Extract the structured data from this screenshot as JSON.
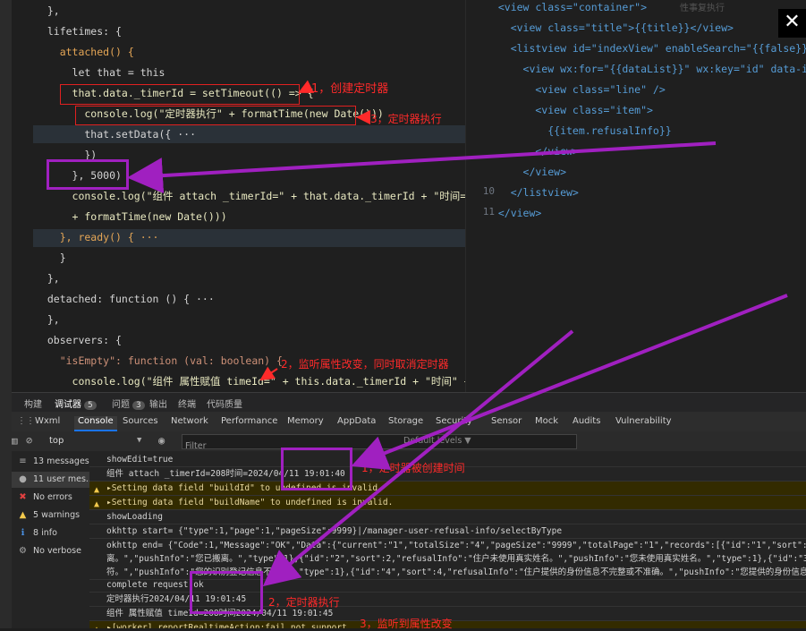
{
  "top_text": "性事复执行",
  "editor": {
    "lines": [
      {
        "t": "  },"
      },
      {
        "t": "  lifetimes: {"
      },
      {
        "t": "    attached() {"
      },
      {
        "t": "      let that = this"
      },
      {
        "t": "      that.data._timerId = setTimeout(() => {"
      },
      {
        "t": "        console.log(\"定时器执行\" + formatTime(new Date()))"
      },
      {
        "t": "        that.setData({ ···"
      },
      {
        "t": "        })"
      },
      {
        "t": "      }, 5000)"
      },
      {
        "t": "      console.log(\"组件 attach _timerId=\" + that.data._timerId + \"时间=\""
      },
      {
        "t": "      + formatTime(new Date()))"
      },
      {
        "t": "    }, ready() { ···"
      },
      {
        "t": "    }"
      },
      {
        "t": "  },"
      },
      {
        "t": "  detached: function () { ···"
      },
      {
        "t": "  },"
      },
      {
        "t": "  observers: {"
      },
      {
        "t": "    \"isEmpty\": function (val: boolean) {"
      },
      {
        "t": "      console.log(\"组件 属性赋值 timeId=\" + this.data._timerId + \"时间\" +"
      }
    ]
  },
  "editor2": {
    "line_numbers": [
      "",
      "",
      "",
      "",
      "",
      "",
      "",
      "",
      "",
      "10",
      "11"
    ],
    "lines": [
      {
        "t": "  <view class=\"container\">"
      },
      {
        "t": "    <view class=\"title\">{{title}}</view>"
      },
      {
        "t": "    <listview id=\"indexView\" enableSearch=\"{{false}}\">"
      },
      {
        "t": "      <view wx:for=\"{{dataList}}\" wx:key=\"id\" data-id=\"{{"
      },
      {
        "t": "        <view class=\"line\" />"
      },
      {
        "t": "        <view class=\"item\">"
      },
      {
        "t": "          {{item.refusalInfo}}"
      },
      {
        "t": "        </view>"
      },
      {
        "t": "      </view>"
      },
      {
        "t": "    </listview>"
      },
      {
        "t": "  </view>"
      }
    ]
  },
  "panel_tabs": [
    {
      "label": "构建",
      "badge": ""
    },
    {
      "label": "调试器",
      "badge": "5"
    },
    {
      "label": "问题",
      "badge": "3"
    },
    {
      "label": "输出",
      "badge": ""
    },
    {
      "label": "终端",
      "badge": ""
    },
    {
      "label": "代码质量",
      "badge": ""
    }
  ],
  "devtools_tabs": [
    "Wxml",
    "Console",
    "Sources",
    "Network",
    "Performance",
    "Memory",
    "AppData",
    "Storage",
    "Security",
    "Sensor",
    "Mock",
    "Audits",
    "Vulnerability"
  ],
  "filter": {
    "context": "top",
    "placeholder": "Filter",
    "levels": "Default levels ▼"
  },
  "sidebar": [
    {
      "icon": "≡",
      "label": "13 messages"
    },
    {
      "icon": "●",
      "label": "11 user mes..."
    },
    {
      "icon": "✖",
      "label": "No errors"
    },
    {
      "icon": "▲",
      "label": "5 warnings"
    },
    {
      "icon": "ℹ",
      "label": "8 info"
    },
    {
      "icon": "⚙",
      "label": "No verbose"
    }
  ],
  "console_rows": [
    {
      "t": "showEdit=true",
      "warn": false
    },
    {
      "t": "组件 attach _timerId=208时间=2024/04/11 19:01:40",
      "warn": false
    },
    {
      "t": "▸Setting data field \"buildId\" to undefined is invalid.",
      "warn": true
    },
    {
      "t": "▸Setting data field \"buildName\" to undefined is invalid.",
      "warn": true
    },
    {
      "t": "showLoading",
      "warn": false
    },
    {
      "t": "okhttp start= {\"type\":1,\"page\":1,\"pageSize\":9999}|/manager-user-refusal-info/selectByType",
      "warn": false
    },
    {
      "t": "okhttp end= {\"Code\":1,\"Message\":\"OK\",\"Data\":{\"current\":\"1\",\"totalSize\":\"4\",\"pageSize\":\"9999\",\"totalPage\":\"1\",\"records\":[{\"id\":\"1\",\"sort\":1,\"refus\n离。\",\"pushInfo\":\"您已搬离。\",\"type\":1},{\"id\":\"2\",\"sort\":2,\"refusalInfo\":\"住户未使用真实姓名。\",\"pushInfo\":\"您未使用真实姓名。\",\"type\":1},{\"id\":\"3\",\"\n符。\",\"pushInfo\":\"您的识别登记信息不符。\",\"type\":1},{\"id\":\"4\",\"sort\":4,\"refusalInfo\":\"住户提供的身份信息不完整或不准确。\",\"pushInfo\":\"您提供的身份信息不",
      "warn": false
    },
    {
      "t": "complete request:ok",
      "warn": false
    },
    {
      "t": "定时器执行2024/04/11 19:01:45",
      "warn": false
    },
    {
      "t": "组件 属性赋值 timeId=208时间2024/04/11 19:01:45",
      "warn": false
    },
    {
      "t": "▸[worker] reportRealtimeAction:fail not support",
      "warn": true
    }
  ],
  "annotations": [
    "1，创建定时器",
    "3，定时器执行",
    "2，监听属性改变，同时取消定时器",
    "1，定时器被创建时间",
    "2，定时器执行",
    "3，监听到属性改变"
  ]
}
